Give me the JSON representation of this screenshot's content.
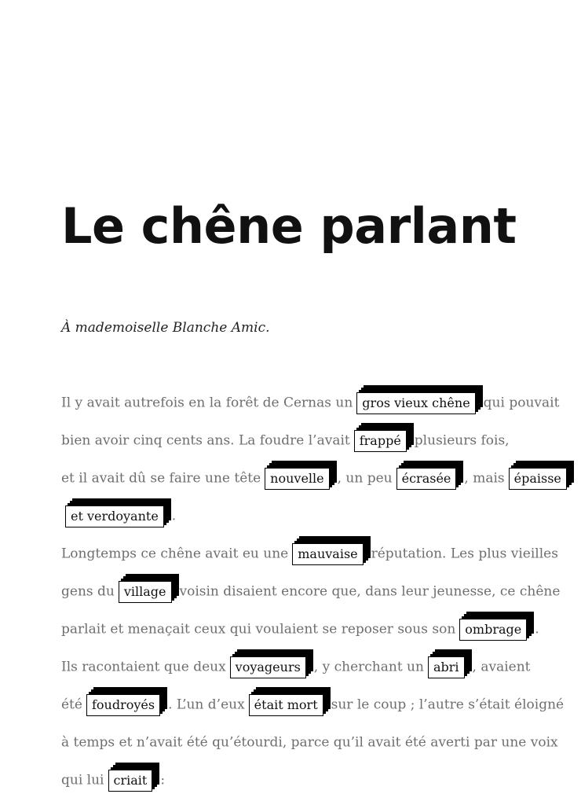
{
  "title": "Le chêne parlant",
  "dedication": "À mademoiselle Blanche Amic.",
  "paragraph_lines": [
    [
      {
        "text": "Il y avait autrefois en la forêt de Cernas un"
      },
      {
        "text": "gros vieux chêne",
        "highlight": true
      },
      {
        "text": "qui pouvait"
      }
    ],
    [
      {
        "text": "bien avoir cinq cents ans. La foudre l’avait"
      },
      {
        "text": "frappé",
        "highlight": true
      },
      {
        "text": "plusieurs fois,"
      }
    ],
    [
      {
        "text": "et il avait dû se faire une tête"
      },
      {
        "text": "nouvelle",
        "highlight": true
      },
      {
        "text": ", un peu"
      },
      {
        "text": "écrasée",
        "highlight": true
      },
      {
        "text": ", mais"
      },
      {
        "text": "épaisse",
        "highlight": true
      }
    ],
    [
      {
        "text": "et verdoyante",
        "highlight": true
      },
      {
        "text": "."
      }
    ],
    [
      {
        "text": "Longtemps ce chêne avait eu une"
      },
      {
        "text": "mauvaise",
        "highlight": true
      },
      {
        "text": "réputation. Les plus vieilles"
      }
    ],
    [
      {
        "text": "gens du"
      },
      {
        "text": "village",
        "highlight": true
      },
      {
        "text": "voisin disaient encore que, dans leur jeunesse, ce chêne"
      }
    ],
    [
      {
        "text": "parlait et menaçait ceux qui voulaient se reposer sous son"
      },
      {
        "text": "ombrage",
        "highlight": true
      },
      {
        "text": "."
      }
    ],
    [
      {
        "text": "Ils racontaient que deux"
      },
      {
        "text": "voyageurs",
        "highlight": true
      },
      {
        "text": ", y cherchant un"
      },
      {
        "text": "abri",
        "highlight": true
      },
      {
        "text": ", avaient"
      }
    ],
    [
      {
        "text": "été"
      },
      {
        "text": "foudroyés",
        "highlight": true
      },
      {
        "text": ". L’un d’eux"
      },
      {
        "text": "était mort",
        "highlight": true
      },
      {
        "text": "sur le coup ; l’autre s’était éloigné"
      }
    ],
    [
      {
        "text": "à temps et n’avait été qu’étourdi, parce qu’il avait été averti par une voix"
      }
    ],
    [
      {
        "text": "qui lui"
      },
      {
        "text": "criait",
        "highlight": true
      },
      {
        "text": ":"
      }
    ]
  ]
}
